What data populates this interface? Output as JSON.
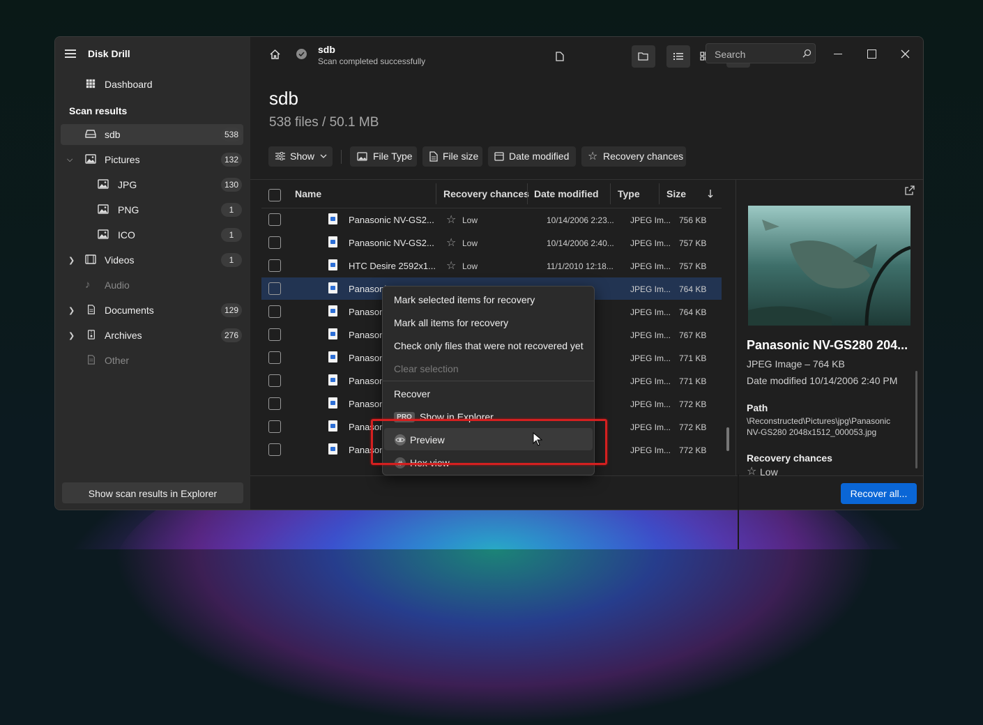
{
  "app": {
    "title": "Disk Drill"
  },
  "sidebar": {
    "dashboard": "Dashboard",
    "section_title": "Scan results",
    "items": [
      {
        "label": "sdb",
        "count": "538"
      },
      {
        "label": "Pictures",
        "count": "132"
      },
      {
        "label": "JPG",
        "count": "130"
      },
      {
        "label": "PNG",
        "count": "1"
      },
      {
        "label": "ICO",
        "count": "1"
      },
      {
        "label": "Videos",
        "count": "1"
      },
      {
        "label": "Audio",
        "count": ""
      },
      {
        "label": "Documents",
        "count": "129"
      },
      {
        "label": "Archives",
        "count": "276"
      },
      {
        "label": "Other",
        "count": ""
      }
    ],
    "explorer_button": "Show scan results in Explorer"
  },
  "topbar": {
    "device": "sdb",
    "status": "Scan completed successfully",
    "search_placeholder": "Search"
  },
  "main": {
    "title": "sdb",
    "subtitle": "538 files / 50.1 MB",
    "filters": [
      "Show",
      "File Type",
      "File size",
      "Date modified",
      "Recovery chances"
    ]
  },
  "table": {
    "columns": {
      "name": "Name",
      "recovery": "Recovery chances",
      "date": "Date modified",
      "type": "Type",
      "size": "Size"
    },
    "rows": [
      {
        "name": "Panasonic NV-GS2...",
        "chance": "Low",
        "date": "10/14/2006 2:23...",
        "type": "JPEG Im...",
        "size": "756 KB"
      },
      {
        "name": "Panasonic NV-GS2...",
        "chance": "Low",
        "date": "10/14/2006 2:40...",
        "type": "JPEG Im...",
        "size": "757 KB"
      },
      {
        "name": "HTC Desire 2592x1...",
        "chance": "Low",
        "date": "11/1/2010 12:18...",
        "type": "JPEG Im...",
        "size": "757 KB"
      },
      {
        "name": "Panasoni",
        "chance": "",
        "date": "",
        "type": "JPEG Im...",
        "size": "764 KB"
      },
      {
        "name": "Panason",
        "chance": "",
        "date": "",
        "type": "JPEG Im...",
        "size": "764 KB"
      },
      {
        "name": "Panason",
        "chance": "",
        "date": "",
        "type": "JPEG Im...",
        "size": "767 KB"
      },
      {
        "name": "Panason",
        "chance": "",
        "date": "",
        "type": "JPEG Im...",
        "size": "771 KB"
      },
      {
        "name": "Panason",
        "chance": "",
        "date": "",
        "type": "JPEG Im...",
        "size": "771 KB"
      },
      {
        "name": "Panason",
        "chance": "",
        "date": "",
        "type": "JPEG Im...",
        "size": "772 KB"
      },
      {
        "name": "Panason",
        "chance": "",
        "date": "",
        "type": "JPEG Im...",
        "size": "772 KB"
      },
      {
        "name": "Panason",
        "chance": "",
        "date": "",
        "type": "JPEG Im...",
        "size": "772 KB"
      }
    ]
  },
  "preview": {
    "filename": "Panasonic NV-GS280 204...",
    "type_size": "JPEG Image – 764 KB",
    "date": "Date modified 10/14/2006 2:40 PM",
    "path_label": "Path",
    "path_line1": "\\Reconstructed\\Pictures\\jpg\\Panasonic",
    "path_line2": "NV-GS280 2048x1512_000053.jpg",
    "recovery_label": "Recovery chances",
    "recovery_value": "Low",
    "recover_button": "Recover all..."
  },
  "context_menu": {
    "items": [
      {
        "label": "Mark selected items for recovery"
      },
      {
        "label": "Mark all items for recovery"
      },
      {
        "label": "Check only files that were not recovered yet"
      },
      {
        "label": "Clear selection"
      },
      {
        "label": "Recover"
      },
      {
        "label": "Show in Explorer"
      },
      {
        "label": "Preview"
      },
      {
        "label": "Hex view"
      }
    ],
    "pro_badge": "PRO"
  },
  "colors": {
    "accent": "#0a66d6",
    "highlight": "#d42020",
    "selected_row": "#223452"
  }
}
